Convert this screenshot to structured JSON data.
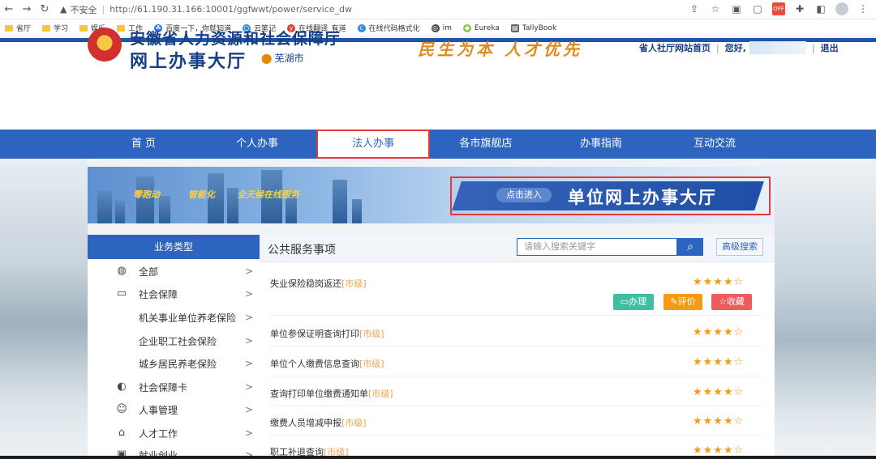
{
  "browser": {
    "security_label": "不安全",
    "url": "http://61.190.31.166:10001/ggfwwt/power/service_dw",
    "bookmarks": [
      {
        "label": "省厅",
        "kind": "folder"
      },
      {
        "label": "学习",
        "kind": "folder"
      },
      {
        "label": "娱乐",
        "kind": "folder"
      },
      {
        "label": "工作",
        "kind": "folder"
      },
      {
        "label": "百度一下，你就知道",
        "kind": "baidu"
      },
      {
        "label": "云笔记",
        "kind": "cloud"
      },
      {
        "label": "在线翻译_有道",
        "kind": "youdao"
      },
      {
        "label": "在线代码格式化",
        "kind": "code"
      },
      {
        "label": "im",
        "kind": "globe"
      },
      {
        "label": "Eureka",
        "kind": "leaf"
      },
      {
        "label": "TallyBook",
        "kind": "book"
      }
    ],
    "ext_off_label": "OFF"
  },
  "header": {
    "title_line1": "安徽省人力资源和社会保障厅",
    "title_line2": "网上办事大厅",
    "city": "芜湖市",
    "slogan": "民生为本 人才优先",
    "home_link": "省人社厅网站首页",
    "greeting": "您好,",
    "logout": "退出"
  },
  "nav": {
    "items": [
      {
        "label": "首 页"
      },
      {
        "label": "个人办事"
      },
      {
        "label": "法人办事"
      },
      {
        "label": "各市旗舰店"
      },
      {
        "label": "办事指南"
      },
      {
        "label": "互动交流"
      }
    ],
    "active_index": 2
  },
  "banner": {
    "tags": [
      "零跑动",
      "智能化",
      "全天候在线服务"
    ],
    "enter_label": "点击进入",
    "hall_label": "单位网上办事大厅"
  },
  "sidebar": {
    "header": "业务类型",
    "items": [
      {
        "label": "全部",
        "icon": "globe-icon",
        "sub": false
      },
      {
        "label": "社会保障",
        "icon": "card-icon",
        "sub": false
      },
      {
        "label": "机关事业单位养老保险",
        "icon": "",
        "sub": true
      },
      {
        "label": "企业职工社会保险",
        "icon": "",
        "sub": true
      },
      {
        "label": "城乡居民养老保险",
        "icon": "",
        "sub": true
      },
      {
        "label": "社会保障卡",
        "icon": "ssc-card-icon",
        "sub": false
      },
      {
        "label": "人事管理",
        "icon": "person-icon",
        "sub": false
      },
      {
        "label": "人才工作",
        "icon": "graduation-cap-icon",
        "sub": false
      },
      {
        "label": "就业创业",
        "icon": "briefcase-icon",
        "sub": false
      }
    ]
  },
  "main": {
    "title": "公共服务事项",
    "search_placeholder": "请输入搜索关键字",
    "advanced_search": "高级搜索",
    "services": [
      {
        "name": "失业保险稳岗返还",
        "level": "[市级]",
        "stars": "★★★★☆",
        "rating": 4.5,
        "actions": true
      },
      {
        "name": "单位参保证明查询打印",
        "level": "[市级]",
        "stars": "★★★★☆",
        "rating": 3.5,
        "actions": false
      },
      {
        "name": "单位个人缴费信息查询",
        "level": "[市级]",
        "stars": "★★★★☆",
        "rating": 3.5,
        "actions": false
      },
      {
        "name": "查询打印单位缴费通知单",
        "level": "[市级]",
        "stars": "★★★★☆",
        "rating": 3.5,
        "actions": false
      },
      {
        "name": "缴费人员增减申报",
        "level": "[市级]",
        "stars": "★★★★☆",
        "rating": 3.5,
        "actions": false
      },
      {
        "name": "职工补退查询",
        "level": "[市级]",
        "stars": "★★★★☆",
        "rating": 3.5,
        "actions": false
      }
    ],
    "action_labels": {
      "do": "办理",
      "rate": "评价",
      "fav": "收藏"
    }
  },
  "colors": {
    "nav_blue": "#2d64c0",
    "title_blue": "#163f86",
    "highlight_red": "#e53935",
    "star_orange": "#f39c12",
    "do_green": "#3dbfa3",
    "rate_orange": "#f39c12",
    "fav_red": "#ef5a5a"
  }
}
